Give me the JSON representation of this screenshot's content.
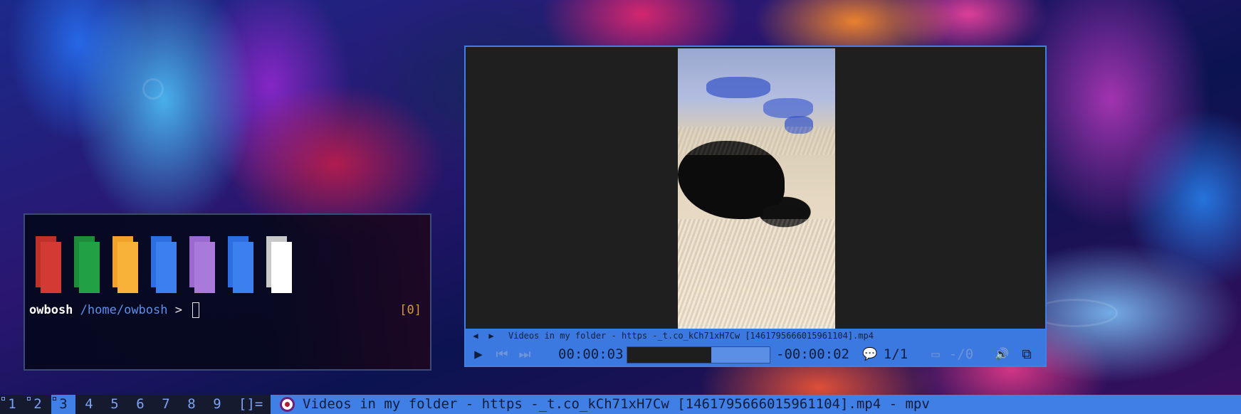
{
  "terminal": {
    "user": "owbosh",
    "path": "/home/owbosh",
    "prompt_symbol": ">",
    "status": "[0]",
    "palette": [
      {
        "dark": "#c0302a",
        "light": "#d33a33"
      },
      {
        "dark": "#1d8b3a",
        "light": "#22a046"
      },
      {
        "dark": "#f2a22a",
        "light": "#f8b23a"
      },
      {
        "dark": "#2d6fe0",
        "light": "#3c7fee"
      },
      {
        "dark": "#9a6ad0",
        "light": "#a97ad9"
      },
      {
        "dark": "#2d6fe0",
        "light": "#3c7fee"
      },
      {
        "dark": "#c9c9c9",
        "light": "#ffffff"
      }
    ]
  },
  "mpv": {
    "title": "Videos in my folder - https -_t.co_kCh71xH7Cw [1461795666015961104].mp4",
    "elapsed": "00:00:03",
    "remaining": "-00:00:02",
    "playlist_pos": "1/1",
    "subtitle_track": "-/0",
    "progress": 0.59,
    "icons": {
      "prev_nav": "◀",
      "next_nav": "▶",
      "play": "▶",
      "skip_back": "⏮",
      "skip_forward": "⏭",
      "chat": "💬",
      "subtitle": "▭",
      "volume": "🔊",
      "fullscreen": "⧉"
    }
  },
  "taskbar": {
    "workspaces": [
      "1",
      "2",
      "3",
      "4",
      "5",
      "6",
      "7",
      "8",
      "9"
    ],
    "active_workspace": "3",
    "layout": "[]=",
    "window_title": "Videos in my folder - https -_t.co_kCh71xH7Cw [1461795666015961104].mp4 - mpv"
  }
}
